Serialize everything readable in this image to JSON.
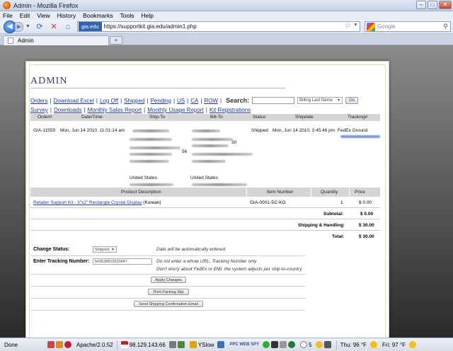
{
  "window": {
    "title": "Admin - Mozilla Firefox",
    "controls": [
      "–",
      "□",
      "✕"
    ]
  },
  "menu": [
    "File",
    "Edit",
    "View",
    "History",
    "Bookmarks",
    "Tools",
    "Help"
  ],
  "nav": {
    "site_identity": "gia.edu",
    "url": "https://supportkit.gia.edu/admin1.php",
    "search_placeholder": "Google"
  },
  "tab": {
    "title": "Admin",
    "new_tab": "+"
  },
  "page": {
    "heading": "ADMIN",
    "links_row1": [
      "Orders",
      "Download Excel",
      "Log Off",
      "Shipped",
      "Pending",
      "US",
      "CA",
      "ROW"
    ],
    "search_label": "Search:",
    "search_field_option": "Billing Last Name",
    "go_label": "Go",
    "links_row2": [
      "Survey",
      "Downloads",
      "Monthly Sales Report",
      "Monthly Usage Report",
      "Kit Registrations"
    ],
    "order_headers": {
      "order": "Order#",
      "datetime": "Date/Time",
      "shipto": "Ship-To",
      "billto": "Bill-To",
      "status": "Status",
      "shipdate": "Shipdate",
      "tracking": "Tracking#"
    },
    "order": {
      "number": "GIA-11559",
      "datetime": "Mon, Jun 14 2010, 11:01:14 am",
      "ship_country": "United States",
      "bill_country": "United States",
      "bill_fragment_1": "30",
      "ship_fragment_1": "56",
      "status": "Shipped",
      "shipdate": "Mon, Jun 14 2010, 3:45:46 pm",
      "carrier": "FedEx Ground"
    },
    "product_headers": {
      "description": "Product Description",
      "item": "Item Number",
      "qty": "Quantity",
      "price": "Price"
    },
    "product": {
      "name": "Retailer Support Kit - 3\"x2\" Rectangle Crystal Display",
      "language": "(Korean)",
      "item_number": "GIA-0001-SC-KO",
      "quantity": "1",
      "price": "$ 0.00"
    },
    "totals": {
      "subtotal_label": "Subtotal:",
      "subtotal": "$ 0.00",
      "shipping_label": "Shipping & Handling:",
      "shipping": "$ 30.00",
      "total_label": "Total:",
      "total": "$ 30.00"
    },
    "form": {
      "change_status_label": "Change Status:",
      "status_value": "Shipped",
      "status_note": "Date will be automatically entered",
      "tracking_label": "Enter Tracking Number:",
      "tracking_value": "543538810020847",
      "tracking_note1": "Do not enter a whole URL, Tracking Number only",
      "tracking_note2": "Don't worry about FedEx or EMI, the system adjusts per ship-to-country",
      "apply_btn": "Apply Changes",
      "print_btn": "Print Packing Slip",
      "email_btn": "Send Shipping Confirmation Email"
    }
  },
  "statusbar": {
    "done": "Done",
    "server": "Apache/2.0.52",
    "ip": "98.129.143.66",
    "yslow": "YSlow",
    "ppc": "PPC WEB SPY",
    "count": "5",
    "weather1": "Thu: 96 °F",
    "weather2": "Fri: 97 °F"
  }
}
